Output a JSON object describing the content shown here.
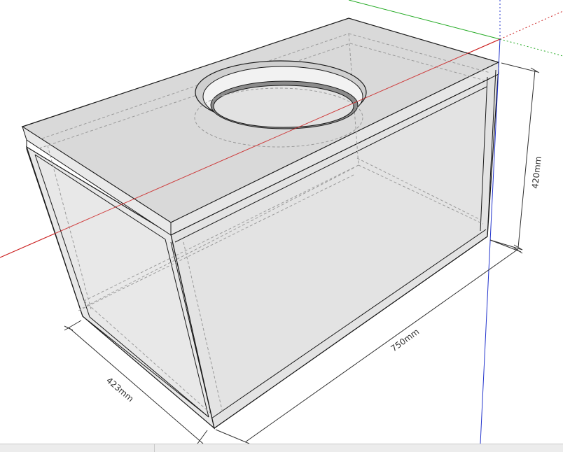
{
  "dimensions": {
    "height_label": "420mm",
    "length_label": "750mm",
    "depth_label": "423mm"
  },
  "colors": {
    "axis_red": "#cc2222",
    "axis_green": "#22aa22",
    "axis_blue": "#2233cc",
    "edge": "#1a1a1a",
    "face_top": "#dcdcdc",
    "face_side": "#e4e4e4",
    "hidden_line": "#9a9a9a"
  },
  "model": {
    "name": "subwoofer-box",
    "feature": "round speaker cutout"
  }
}
